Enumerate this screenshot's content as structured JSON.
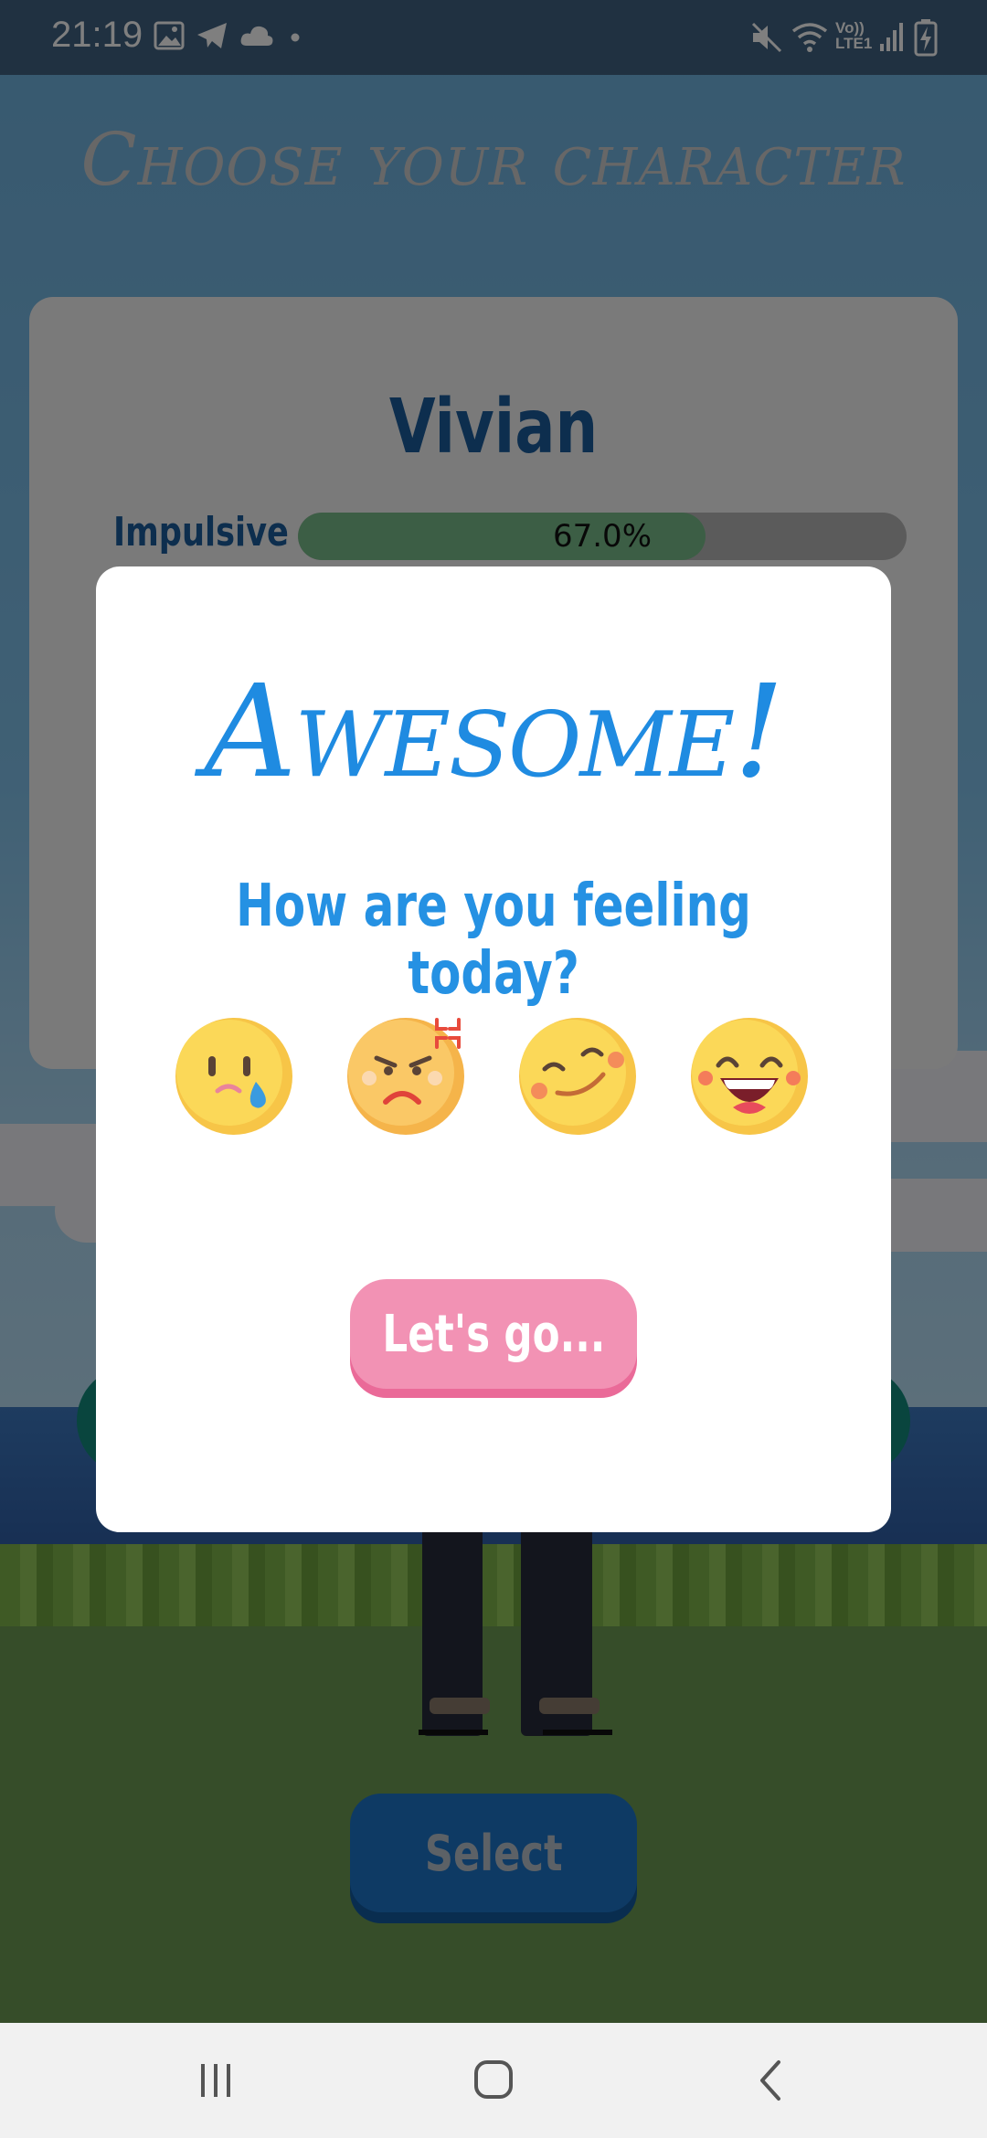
{
  "status_bar": {
    "time": "21:19",
    "left_icons": [
      "image-icon",
      "telegram-icon",
      "cloud-icon",
      "dot-icon"
    ],
    "right_icons": [
      "mute-icon",
      "wifi-icon",
      "volte-icon",
      "signal-icon",
      "battery-charging-icon"
    ],
    "network_label_top": "Vo))",
    "network_label_bottom": "LTE1"
  },
  "app": {
    "title": "Choose your character",
    "character": {
      "name": "Vivian",
      "trait_label": "Impulsive",
      "trait_value_percent": 67.0,
      "trait_text": "67.0%"
    },
    "select_label": "Select",
    "colors": {
      "accent_blue": "#1b5d9c",
      "button_blue": "#1d74c9",
      "trait_fill": "#79bd8b"
    }
  },
  "dialog": {
    "title": "Awesome!",
    "question": "How are you feeling today?",
    "moods": [
      "sad-crying",
      "angry",
      "content",
      "laughing"
    ],
    "go_label": "Let's go...",
    "colors": {
      "title": "#1f8be1",
      "go_button": "#f292b4"
    }
  },
  "nav_bar": {
    "buttons": [
      "recent-apps-icon",
      "home-icon",
      "back-icon"
    ]
  }
}
